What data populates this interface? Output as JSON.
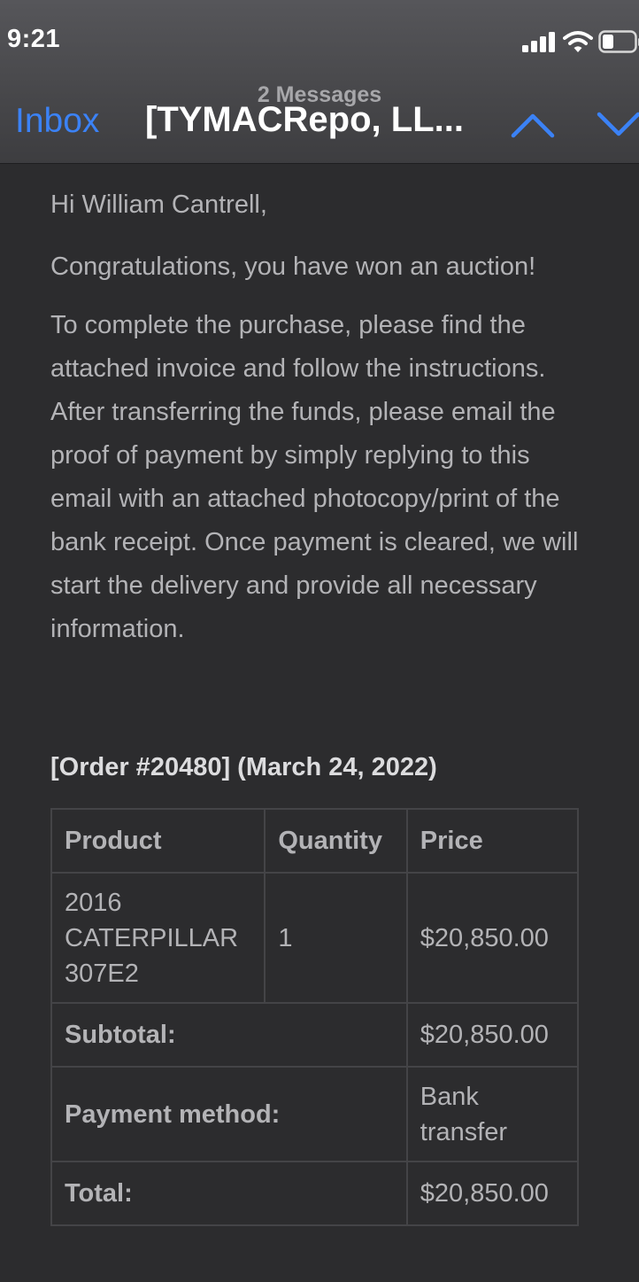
{
  "status_bar": {
    "time": "9:21",
    "icons": [
      "signal-bars-icon",
      "wifi-icon",
      "battery-icon"
    ]
  },
  "nav": {
    "back_label": "Inbox",
    "subtitle": "2 Messages",
    "title": "[TYMACRepo, LL...",
    "accent_color": "#3b82f6"
  },
  "email": {
    "greeting": "Hi William Cantrell,",
    "paragraph1": "Congratulations, you have won an auction!",
    "paragraph2": "To complete the purchase, please find the attached invoice and follow the instructions. After transferring the funds, please email the proof of payment by simply replying to this email with an attached photocopy/print of the bank receipt. Once payment is cleared, we will start the delivery and provide all necessary information.",
    "order_heading": "[Order #20480] (March 24, 2022)",
    "table": {
      "headers": [
        "Product",
        "Quantity",
        "Price"
      ],
      "item": {
        "product": "2016 CATERPILLAR 307E2",
        "quantity": "1",
        "price": "$20,850.00"
      },
      "subtotal_label": "Subtotal:",
      "subtotal_value": "$20,850.00",
      "payment_label": "Payment method:",
      "payment_value": "Bank transfer",
      "total_label": "Total:",
      "total_value": "$20,850.00"
    }
  }
}
